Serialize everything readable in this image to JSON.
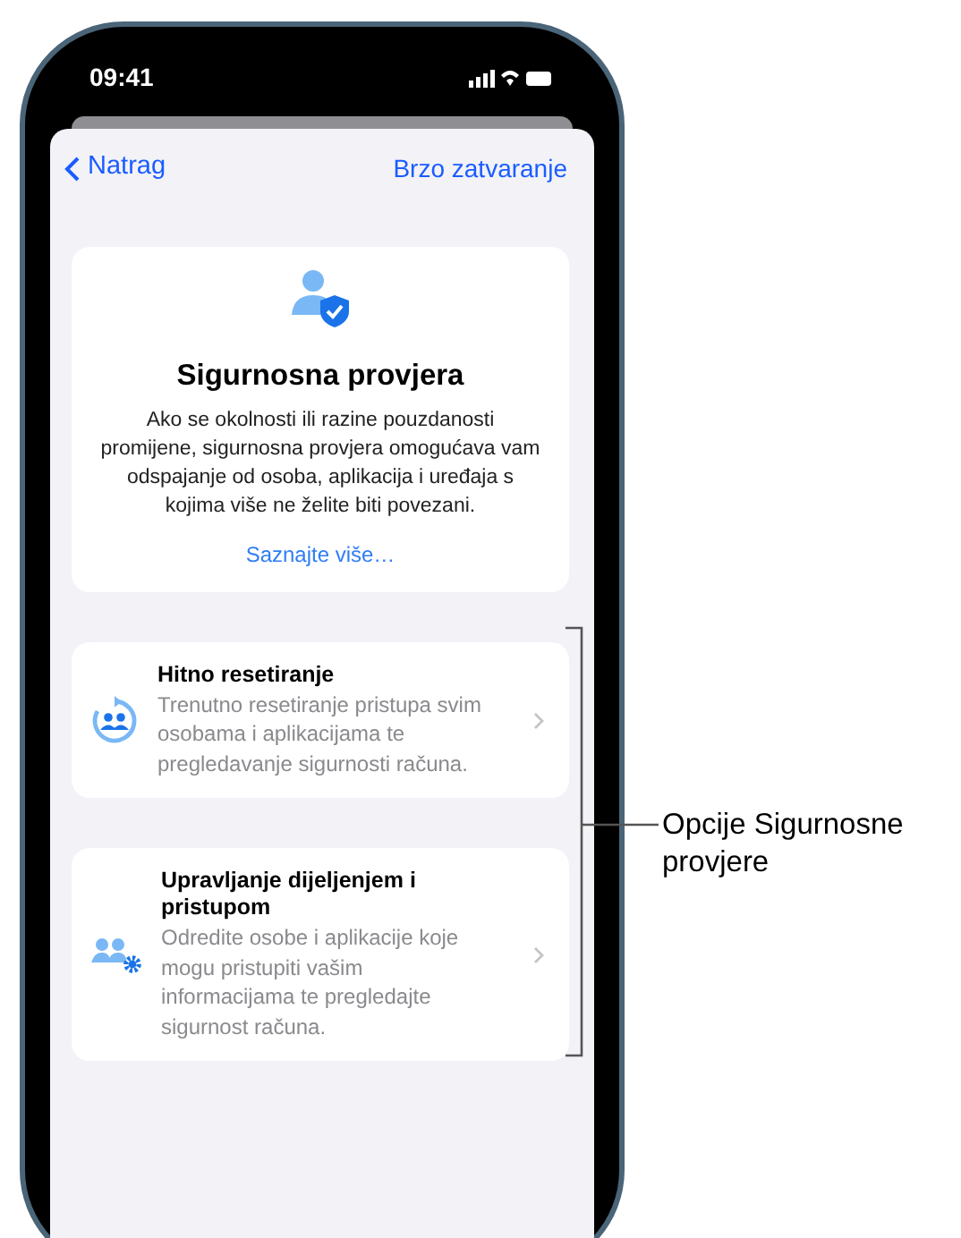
{
  "status_bar": {
    "time": "09:41"
  },
  "nav": {
    "back": "Natrag",
    "action": "Brzo zatvaranje"
  },
  "header": {
    "title": "Sigurnosna provjera",
    "description": "Ako se okolnosti ili razine pouzdanosti promijene, sigurnosna provjera omogućava vam odspajanje od osoba, aplikacija i uređaja s kojima više ne želite biti povezani.",
    "link": "Saznajte više…"
  },
  "options": [
    {
      "kind": "reset",
      "title": "Hitno resetiranje",
      "description": "Trenutno resetiranje pristupa svim osobama i aplikacijama te pregledavanje sigurnosti računa."
    },
    {
      "kind": "manage",
      "title": "Upravljanje dijeljenjem i pristupom",
      "description": "Odredite osobe i aplikacije koje mogu pristupiti vašim informacijama te pregledajte sigurnost računa."
    }
  ],
  "callout": {
    "label": "Opcije Sigurnosne provjere"
  }
}
